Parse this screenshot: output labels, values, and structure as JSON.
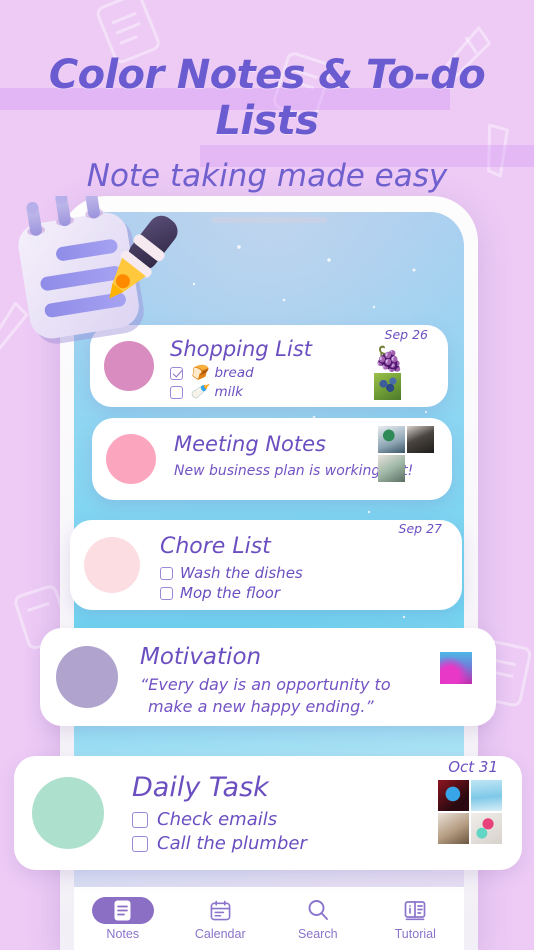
{
  "headings": {
    "title": "Color Notes & To-do Lists",
    "subtitle": "Note taking made easy"
  },
  "colors": {
    "background": "#EDCBF5",
    "title_purple": "#6B5BD0",
    "accent_purple": "#8B6FC4",
    "note_text": "#6B4FC0",
    "screen_blue": "#6FD4F0"
  },
  "notes": [
    {
      "title": "Shopping List",
      "date": "Sep 26",
      "dot_color": "#D98CBF",
      "items": [
        {
          "checked": true,
          "emoji": "🍞",
          "label": "bread"
        },
        {
          "checked": false,
          "emoji": "🍼",
          "label": "milk"
        }
      ],
      "thumbs": [
        "watermelon-emoji",
        "grapes-photo"
      ]
    },
    {
      "title": "Meeting Notes",
      "date": "",
      "dot_color": "#FCA5BE",
      "body": "New business plan is working out!",
      "thumbs": [
        "plant-photo",
        "laptop-photo",
        "meeting-photo"
      ]
    },
    {
      "title": "Chore List",
      "date": "Sep 27",
      "dot_color": "#FBDDE2",
      "items": [
        {
          "checked": false,
          "label": "Wash the dishes"
        },
        {
          "checked": false,
          "label": "Mop the floor"
        }
      ],
      "thumbs": []
    },
    {
      "title": "Motivation",
      "date": "",
      "dot_color": "#B0A4CE",
      "body_line1": "“Every day is an opportunity to",
      "body_line2": "make a new happy ending.”",
      "thumbs": [
        "galaxy-photo"
      ]
    },
    {
      "title": "Daily Task",
      "date": "Oct 31",
      "dot_color": "#AEE0CE",
      "items": [
        {
          "checked": false,
          "label": "Check emails"
        },
        {
          "checked": false,
          "label": "Call the plumber"
        }
      ],
      "thumbs": [
        "mail-icon-photo",
        "water-glass-photo",
        "desk-photo",
        "gym-photo"
      ]
    }
  ],
  "nav": {
    "items": [
      {
        "label": "Notes",
        "icon": "note-icon",
        "active": true
      },
      {
        "label": "Calendar",
        "icon": "calendar-icon",
        "active": false
      },
      {
        "label": "Search",
        "icon": "search-icon",
        "active": false
      },
      {
        "label": "Tutorial",
        "icon": "book-info-icon",
        "active": false
      }
    ]
  }
}
